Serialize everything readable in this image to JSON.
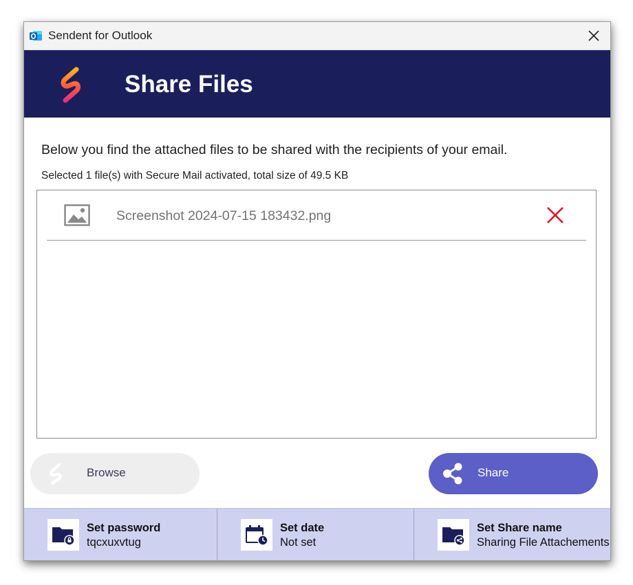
{
  "window": {
    "title": "Sendent for Outlook"
  },
  "header": {
    "heading": "Share Files"
  },
  "content": {
    "intro": "Below you find the attached files to be shared with the recipients of your email.",
    "summary": "Selected 1 file(s) with Secure Mail activated, total size of 49.5 KB"
  },
  "files": [
    {
      "name": "Screenshot 2024-07-15 183432.png",
      "icon": "image-file-icon"
    }
  ],
  "buttons": {
    "browse_label": "Browse",
    "share_label": "Share"
  },
  "options": {
    "password": {
      "title": "Set password",
      "value": "tqcxuxvtug"
    },
    "date": {
      "title": "Set date",
      "value": "Not set"
    },
    "share_name": {
      "title": "Set Share name",
      "value": "Sharing File Attachements"
    }
  },
  "colors": {
    "header_bg": "#1a1f5c",
    "accent": "#5b5fc7",
    "options_bg": "#cfd1f0",
    "remove": "#e81123"
  }
}
